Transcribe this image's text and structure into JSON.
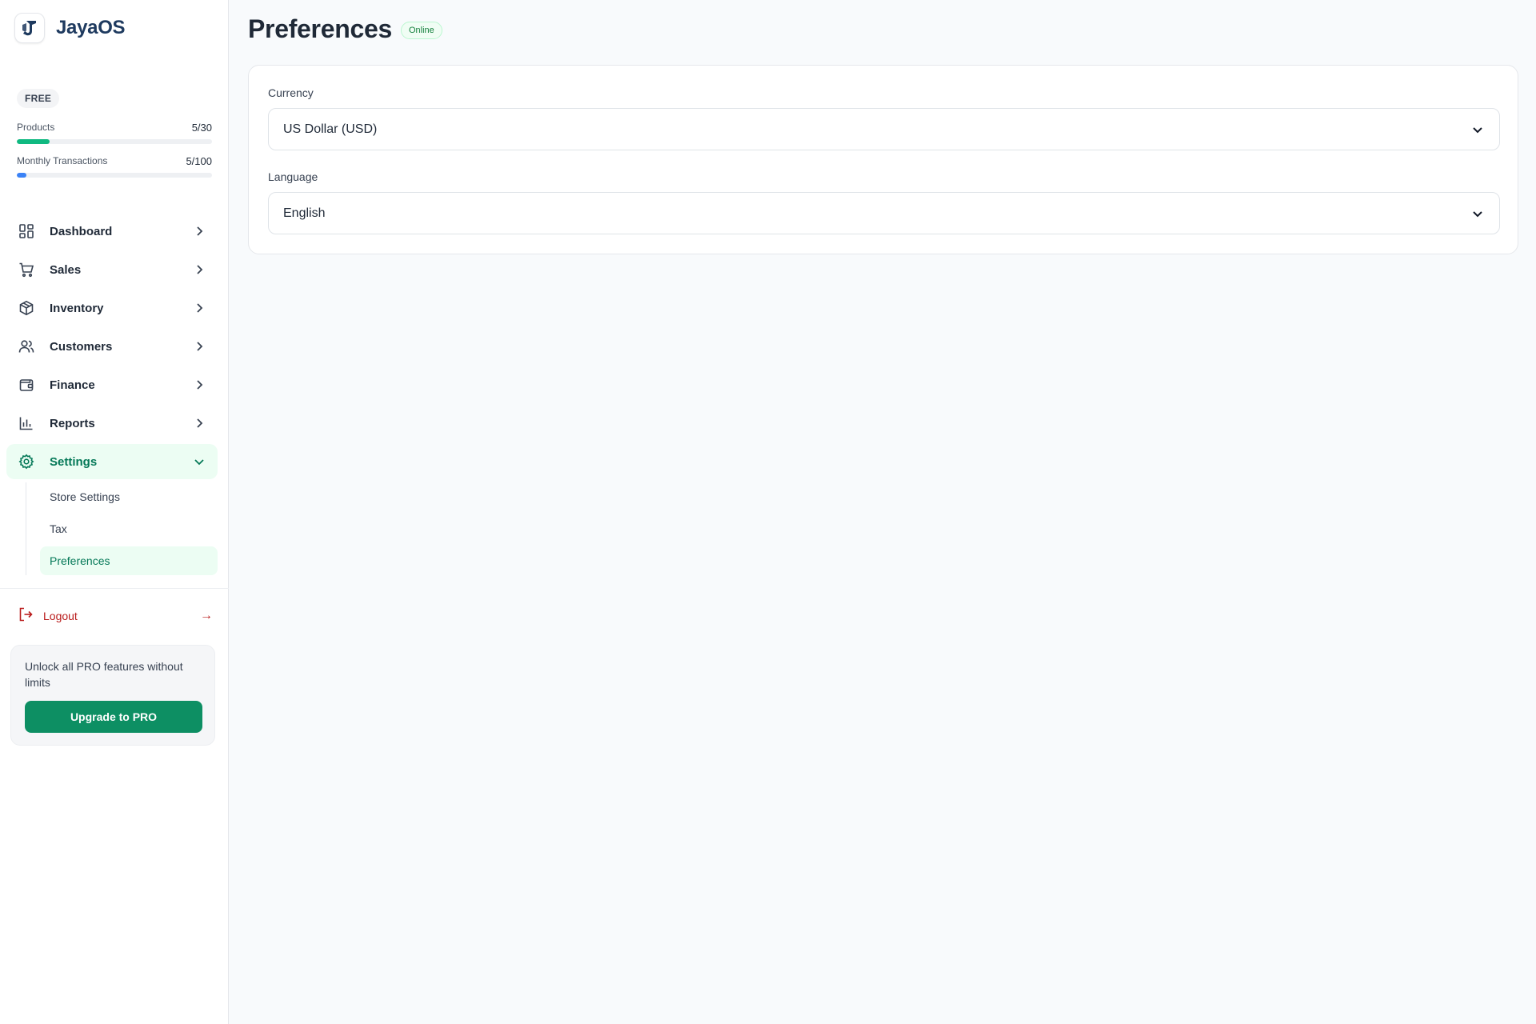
{
  "app": {
    "name": "JayaOS"
  },
  "plan": {
    "badge": "FREE",
    "usage": [
      {
        "label": "Products",
        "value": "5/30",
        "fraction": 0.167,
        "color": "#10b981"
      },
      {
        "label": "Monthly Transactions",
        "value": "5/100",
        "fraction": 0.05,
        "color": "#3b82f6"
      }
    ]
  },
  "nav": {
    "items": [
      {
        "label": "Dashboard",
        "icon": "dashboard-grid-icon"
      },
      {
        "label": "Sales",
        "icon": "shopping-cart-icon"
      },
      {
        "label": "Inventory",
        "icon": "package-box-icon"
      },
      {
        "label": "Customers",
        "icon": "users-icon"
      },
      {
        "label": "Finance",
        "icon": "wallet-icon"
      },
      {
        "label": "Reports",
        "icon": "bar-chart-icon"
      },
      {
        "label": "Settings",
        "icon": "gear-icon",
        "expanded": true
      }
    ],
    "settings_sub": [
      {
        "label": "Store Settings"
      },
      {
        "label": "Tax"
      },
      {
        "label": "Preferences",
        "active": true
      }
    ],
    "logout": {
      "label": "Logout",
      "arrow": "→"
    }
  },
  "promo": {
    "text": "Unlock all PRO features without limits",
    "button": "Upgrade to PRO"
  },
  "main": {
    "title": "Preferences",
    "status": "Online",
    "fields": [
      {
        "label": "Currency",
        "value": "US Dollar (USD)"
      },
      {
        "label": "Language",
        "value": "English"
      }
    ]
  },
  "colors": {
    "accent": "#047857",
    "accent_bg": "#ecfdf3",
    "button": "#0d8f63",
    "danger": "#b91c1c",
    "brand_text": "#1e3a5f"
  }
}
